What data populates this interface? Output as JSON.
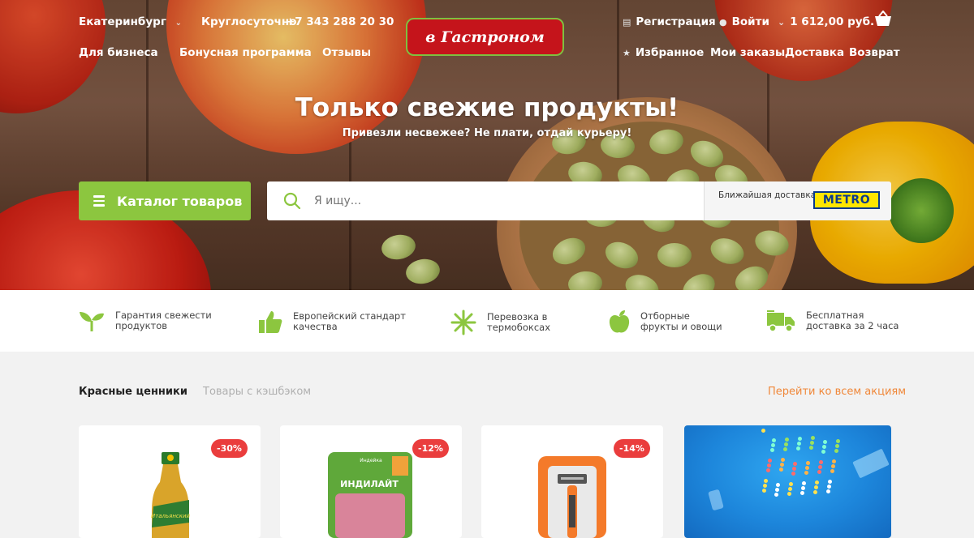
{
  "header": {
    "city": "Екатеринбург",
    "hours_label": "Круглосуточно",
    "phone": "+7 343 288 20 30",
    "logo_text": "в Гастроном",
    "register": "Регистрация",
    "login": "Войти",
    "cart_total": "1 612,00 руб.",
    "nav_left": [
      "Для бизнеса",
      "Бонусная программа",
      "Отзывы"
    ],
    "nav_right": [
      "Избранное",
      "Мои заказы",
      "Доставка",
      "Возврат"
    ]
  },
  "hero": {
    "title": "Только свежие продукты!",
    "subtitle": "Привезли несвежее? Не плати, отдай курьеру!"
  },
  "catalog_button": "Каталог товаров",
  "search": {
    "placeholder": "Я ищу..."
  },
  "delivery": {
    "label": "Ближайшая доставка",
    "store_logo": "METRO"
  },
  "features": [
    "Гарантия свежести\nпродуктов",
    "Европейский стандарт\nкачества",
    "Перевозка в\nтермобоксах",
    "Отборные\nфрукты и овощи",
    "Бесплатная\nдоставка за 2 часа"
  ],
  "promos": {
    "tabs": [
      "Красные ценники",
      "Товары с кэшбэком"
    ],
    "all_link": "Перейти ко всем акциям",
    "products": [
      {
        "discount": "-30%",
        "label": "Итальянский"
      },
      {
        "discount": "-12%",
        "brand": "ИНДИЛАЙТ",
        "subbrand": "Индейка"
      },
      {
        "discount": "-14%"
      }
    ]
  },
  "colors": {
    "green": "#8cc63f",
    "red": "#ea3d3d",
    "orange": "#f0883a",
    "logo_red": "#c5141b"
  }
}
